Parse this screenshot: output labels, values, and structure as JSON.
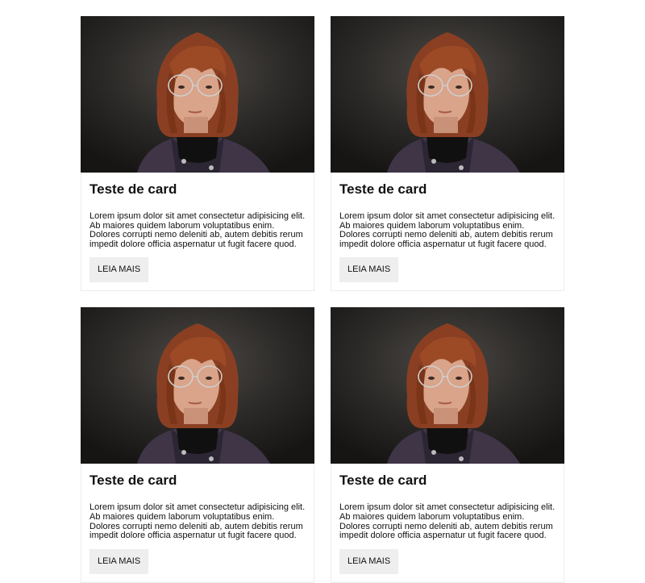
{
  "cards": [
    {
      "image_alt": "Retrato de pessoa com óculos",
      "title": "Teste de card",
      "text": "Lorem ipsum dolor sit amet consectetur adipisicing elit. Ab maiores quidem laborum voluptatibus enim. Dolores corrupti nemo deleniti ab, autem debitis rerum impedit dolore officia aspernatur ut fugit facere quod.",
      "button_label": "LEIA MAIS"
    },
    {
      "image_alt": "Retrato de pessoa com óculos",
      "title": "Teste de card",
      "text": "Lorem ipsum dolor sit amet consectetur adipisicing elit. Ab maiores quidem laborum voluptatibus enim. Dolores corrupti nemo deleniti ab, autem debitis rerum impedit dolore officia aspernatur ut fugit facere quod.",
      "button_label": "LEIA MAIS"
    },
    {
      "image_alt": "Retrato de pessoa com óculos",
      "title": "Teste de card",
      "text": "Lorem ipsum dolor sit amet consectetur adipisicing elit. Ab maiores quidem laborum voluptatibus enim. Dolores corrupti nemo deleniti ab, autem debitis rerum impedit dolore officia aspernatur ut fugit facere quod.",
      "button_label": "LEIA MAIS"
    },
    {
      "image_alt": "Retrato de pessoa com óculos",
      "title": "Teste de card",
      "text": "Lorem ipsum dolor sit amet consectetur adipisicing elit. Ab maiores quidem laborum voluptatibus enim. Dolores corrupti nemo deleniti ab, autem debitis rerum impedit dolore officia aspernatur ut fugit facere quod.",
      "button_label": "LEIA MAIS"
    }
  ],
  "colors": {
    "page_background": "#ffffff",
    "card_border": "#ececec",
    "button_background": "#eeeeee",
    "text": "#111111",
    "photo_background": "#2d2b29"
  }
}
